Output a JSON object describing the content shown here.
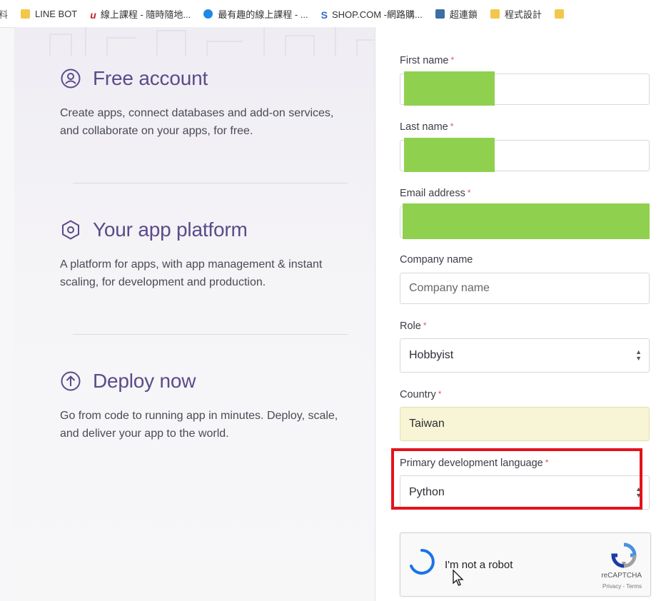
{
  "bookmarks": [
    {
      "icon": "folder-icon",
      "label": "LINE BOT"
    },
    {
      "icon": "udemy-icon",
      "label": "線上課程 - 隨時隨地..."
    },
    {
      "icon": "graduation-cap-icon",
      "label": "最有趣的線上課程 - ..."
    },
    {
      "icon": "shop-icon",
      "label": "SHOP.COM -網路購..."
    },
    {
      "icon": "app-icon",
      "label": "超連鎖"
    },
    {
      "icon": "folder-icon",
      "label": "程式設計"
    }
  ],
  "promo": {
    "sections": [
      {
        "icon": "user-circle-icon",
        "title": "Free account",
        "description": "Create apps, connect databases and add-on services, and collaborate on your apps, for free."
      },
      {
        "icon": "hexagon-icon",
        "title": "Your app platform",
        "description": "A platform for apps, with app management & instant scaling, for development and production."
      },
      {
        "icon": "upload-circle-icon",
        "title": "Deploy now",
        "description": "Go from code to running app in minutes. Deploy, scale, and deliver your app to the world."
      }
    ]
  },
  "form": {
    "required_mark": "*",
    "first_name": {
      "label": "First name",
      "value": ""
    },
    "last_name": {
      "label": "Last name",
      "value": ""
    },
    "email": {
      "label": "Email address",
      "value": ""
    },
    "company": {
      "label": "Company name",
      "placeholder": "Company name"
    },
    "role": {
      "label": "Role",
      "value": "Hobbyist"
    },
    "country": {
      "label": "Country",
      "value": "Taiwan"
    },
    "language": {
      "label": "Primary development language",
      "value": "Python"
    },
    "captcha": {
      "text": "I'm not a robot",
      "brand": "reCAPTCHA",
      "terms": "Privacy - Terms"
    }
  },
  "colors": {
    "accent": "#5b4b8a",
    "redaction": "#8fd14f",
    "highlight_border": "#e4121b",
    "required": "#e0526a",
    "autofill": "#f7f5d5"
  }
}
